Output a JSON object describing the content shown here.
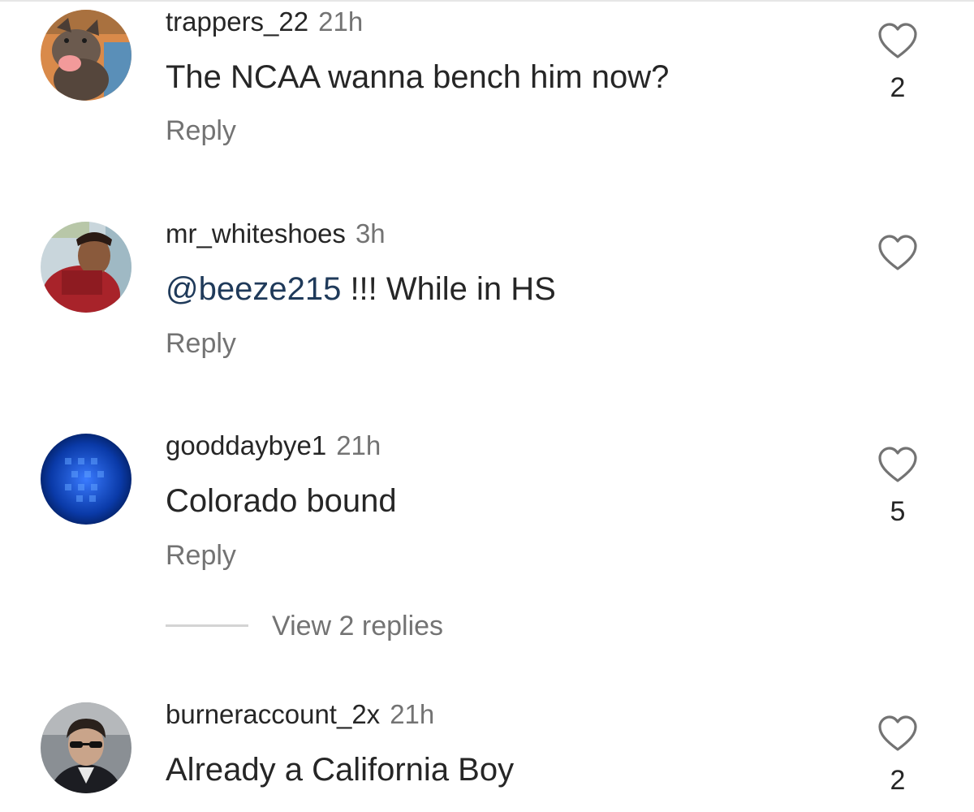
{
  "comments": [
    {
      "username": "trappers_22",
      "time": "21h",
      "text": "The NCAA wanna bench him now?",
      "reply_label": "Reply",
      "likes": "2",
      "avatar_icon": "dog-avatar"
    },
    {
      "username": "mr_whiteshoes",
      "time": "3h",
      "mention": "@beeze215",
      "text": " !!! While in HS",
      "reply_label": "Reply",
      "likes": "",
      "avatar_icon": "person-red-hoodie-avatar"
    },
    {
      "username": "gooddaybye1",
      "time": "21h",
      "text": "Colorado bound",
      "reply_label": "Reply",
      "likes": "5",
      "avatar_icon": "blue-abstract-avatar",
      "view_replies": "View 2 replies"
    },
    {
      "username": "burneraccount_2x",
      "time": "21h",
      "text": "Already a California Boy",
      "reply_label": "Reply",
      "likes": "2",
      "avatar_icon": "person-sunglasses-avatar"
    }
  ],
  "colors": {
    "username": "#262626",
    "secondary": "#737373",
    "mention": "#1f3a5a"
  }
}
